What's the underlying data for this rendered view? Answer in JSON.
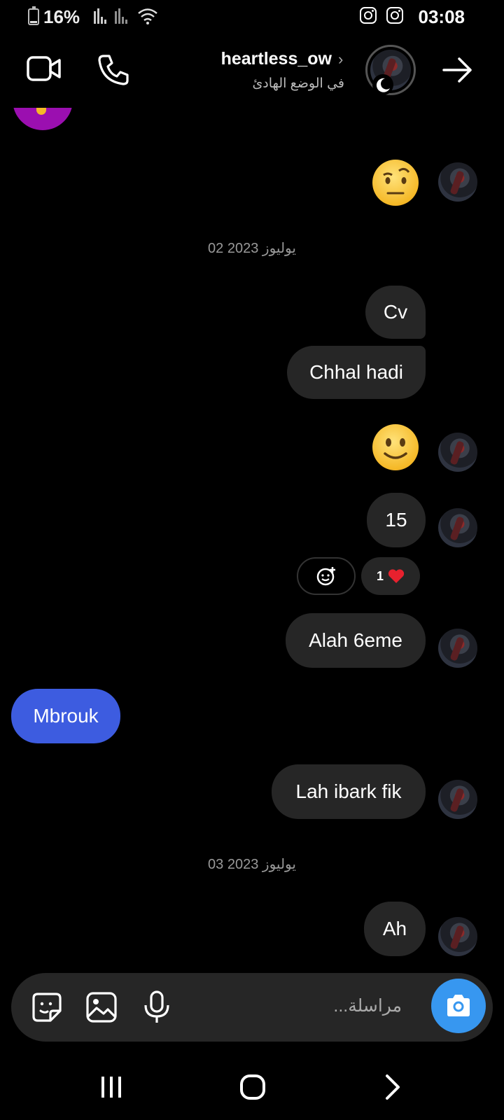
{
  "status_bar": {
    "battery_percent": "16%",
    "battery_level": 0.16,
    "time": "03:08"
  },
  "header": {
    "username": "heartless_ow",
    "status": "في الوضع الهادئ"
  },
  "messages": [
    {
      "type": "emoji",
      "content": "raised-eyebrow-emoji",
      "side": "right"
    },
    {
      "type": "date",
      "text": "02 يوليوز 2023"
    },
    {
      "type": "text",
      "text": "Cv",
      "side": "right"
    },
    {
      "type": "text",
      "text": "Chhal hadi",
      "side": "right"
    },
    {
      "type": "emoji",
      "content": "slightly-smiling-emoji",
      "side": "right"
    },
    {
      "type": "text",
      "text": "15",
      "side": "right",
      "reaction_count": "1",
      "reaction": "heart"
    },
    {
      "type": "text",
      "text": "Alah 6eme",
      "side": "right"
    },
    {
      "type": "text",
      "text": "Mbrouk",
      "side": "left"
    },
    {
      "type": "text",
      "text": "Lah ibark fik",
      "side": "right"
    },
    {
      "type": "date",
      "text": "03 يوليوز 2023"
    },
    {
      "type": "text",
      "text": "Ah",
      "side": "right"
    }
  ],
  "composer": {
    "placeholder": "مراسلة..."
  },
  "colors": {
    "background": "#000000",
    "bubble_theirs": "#262626",
    "bubble_mine": "#3d5ce0",
    "camera_button": "#3797f0",
    "heart": "#e8212e"
  }
}
